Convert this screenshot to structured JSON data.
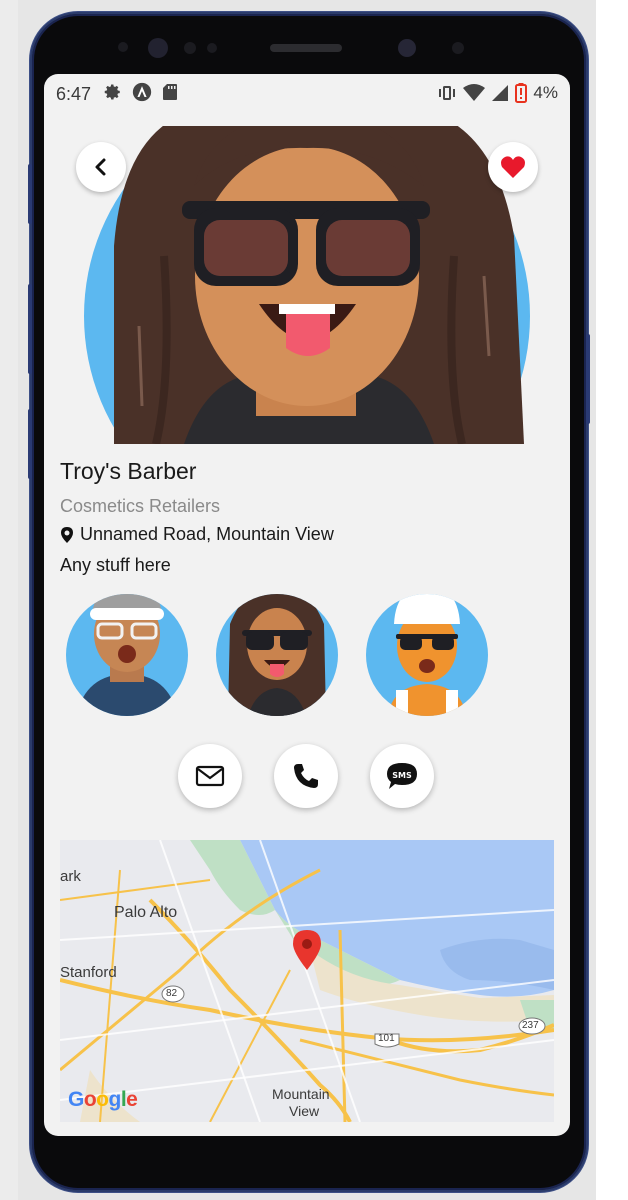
{
  "status_bar": {
    "time": "6:47",
    "battery_percent": "4%",
    "icons": [
      "gear-icon",
      "android-auto-icon",
      "sd-card-icon",
      "vibrate-icon",
      "wifi-icon",
      "signal-icon",
      "battery-low-icon"
    ]
  },
  "header": {
    "back_icon": "chevron-left-icon",
    "favorite_icon": "heart-icon"
  },
  "business": {
    "name": "Troy's Barber",
    "category": "Cosmetics Retailers",
    "address": "Unnamed Road, Mountain View",
    "description": "Any stuff here"
  },
  "contact_actions": {
    "email_icon": "mail-icon",
    "phone_icon": "phone-icon",
    "sms_icon": "sms-icon",
    "sms_text": "SMS"
  },
  "map": {
    "labels": {
      "park": "ark",
      "palo_alto": "Palo Alto",
      "stanford": "Stanford",
      "route_82": "82",
      "route_101": "101",
      "route_237": "237",
      "mountain": "Mountain",
      "view": "View"
    },
    "logo": {
      "G": "G",
      "o1": "o",
      "o2": "o",
      "g": "g",
      "l": "l",
      "e": "e"
    }
  },
  "colors": {
    "accent_red": "#e8192c",
    "avatar_bg": "#5cb8f0",
    "map_water": "#a9c8f5",
    "map_park": "#bfe0c5",
    "map_road": "#f7c24a"
  }
}
